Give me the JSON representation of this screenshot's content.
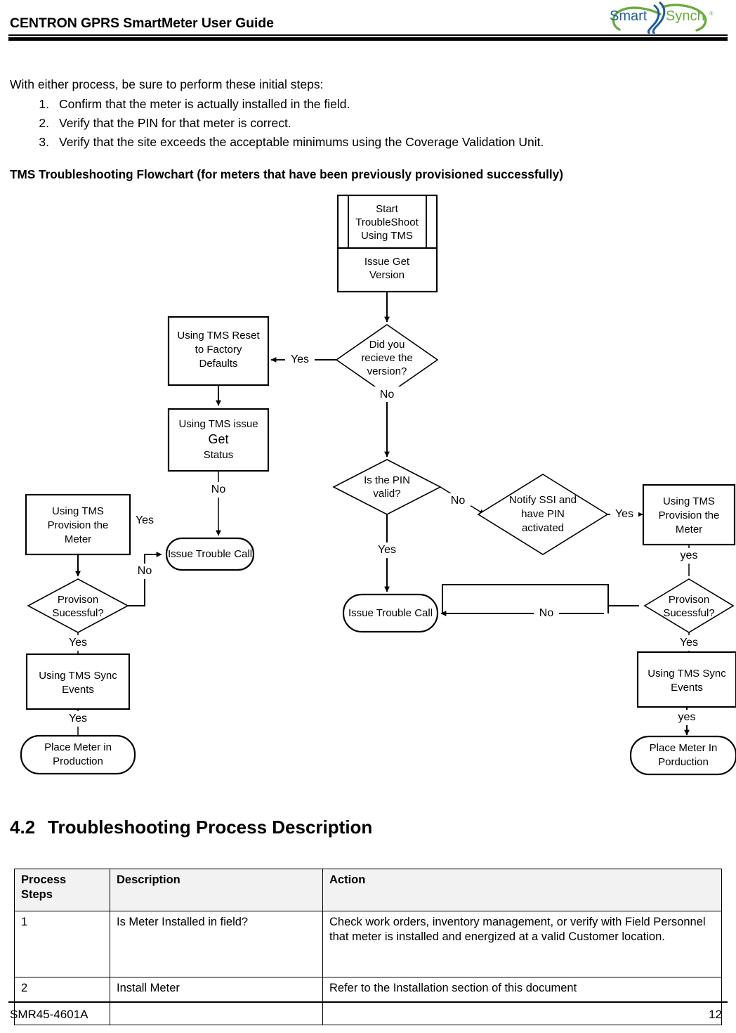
{
  "header": {
    "title": "CENTRON GPRS SmartMeter User Guide",
    "logo": {
      "part1": "Smart",
      "part2": "Synch",
      "trademark": "®",
      "color1": "#1f5c99",
      "color2": "#6aab3f"
    }
  },
  "body": {
    "intro": "With either process, be sure to perform these initial steps:",
    "steps": [
      {
        "num": "1.",
        "text": "Confirm that the meter is actually installed in the field."
      },
      {
        "num": "2.",
        "text": "Verify that the PIN for that meter is correct."
      },
      {
        "num": "3.",
        "text": "Verify that the site exceeds the acceptable minimums using the Coverage Validation Unit."
      }
    ],
    "flowchart_caption": "TMS Troubleshooting Flowchart (for meters that have been previously provisioned successfully)"
  },
  "flowchart": {
    "nodes": {
      "start_line1": "Start",
      "start_line2": "TroubleShoot",
      "start_line3": "Using TMS",
      "issue_get_version_line1": "Issue Get",
      "issue_get_version_line2": "Version",
      "did_receive_line1": "Did you",
      "did_receive_line2": "recieve the",
      "did_receive_line3": "version?",
      "reset_line1": "Using TMS Reset",
      "reset_line2": "to Factory",
      "reset_line3": "Defaults",
      "get_status_line1": "Using TMS issue",
      "get_status_line2": "Get",
      "get_status_line3": "Status",
      "trouble_call_left": "Issue Trouble Call",
      "provision_left_line1": "Using TMS",
      "provision_left_line2": "Provision the",
      "provision_left_line3": "Meter",
      "provison_success_left_line1": "Provison",
      "provison_success_left_line2": "Sucessful?",
      "sync_events_left_line1": "Using TMS Sync",
      "sync_events_left_line2": "Events",
      "place_production_left_line1": "Place Meter in",
      "place_production_left_line2": "Production",
      "pin_valid_line1": "Is the PIN",
      "pin_valid_line2": "valid?",
      "notify_ssi_line1": "Notify SSI and",
      "notify_ssi_line2": "have PIN",
      "notify_ssi_line3": "activated",
      "trouble_call_center": "Issue Trouble Call",
      "provision_right_line1": "Using TMS",
      "provision_right_line2": "Provision the",
      "provision_right_line3": "Meter",
      "provison_success_right_line1": "Provison",
      "provison_success_right_line2": "Sucessful?",
      "sync_events_right_line1": "Using TMS Sync",
      "sync_events_right_line2": "Events",
      "place_production_right_line1": "Place Meter In",
      "place_production_right_line2": "Porduction"
    },
    "edge_labels": {
      "version_yes": "Yes",
      "version_no": "No",
      "get_status_no": "No",
      "provision_left_yes": "Yes",
      "provison_left_no": "No",
      "provison_left_yes": "Yes",
      "sync_left_yes": "Yes",
      "pin_no": "No",
      "pin_yes": "Yes",
      "notify_yes": "Yes",
      "provision_right_yes": "yes",
      "provison_right_no": "No",
      "provison_right_yes": "Yes",
      "sync_right_yes": "yes"
    }
  },
  "section": {
    "number": "4.2",
    "title": "Troubleshooting Process Description"
  },
  "table": {
    "headers": [
      "Process Steps",
      "Description",
      "Action"
    ],
    "header_step_line1": "Process",
    "header_step_line2": "Steps",
    "rows": [
      {
        "step": "1",
        "description": "Is Meter Installed in field?",
        "action": "Check work orders, inventory management, or verify with Field Personnel that meter is installed and energized at a valid Customer location."
      },
      {
        "step": "2",
        "description": "Install Meter",
        "action": "Refer to the Installation section of this document"
      }
    ]
  },
  "footer": {
    "doc_number": "SMR45-4601A",
    "page_number": "12"
  }
}
